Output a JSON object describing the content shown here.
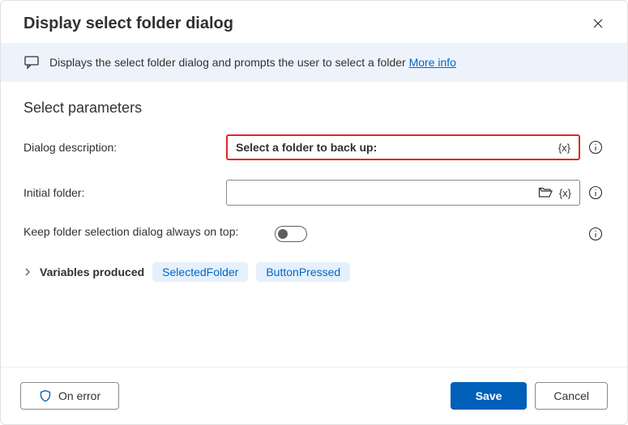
{
  "header": {
    "title": "Display select folder dialog"
  },
  "banner": {
    "text": "Displays the select folder dialog and prompts the user to select a folder ",
    "link": "More info"
  },
  "section": {
    "title": "Select parameters"
  },
  "fields": {
    "dialog_description": {
      "label": "Dialog description:",
      "value": "Select a folder to back up:"
    },
    "initial_folder": {
      "label": "Initial folder:",
      "value": ""
    },
    "keep_on_top": {
      "label": "Keep folder selection dialog always on top:",
      "toggled": false
    }
  },
  "variables": {
    "label": "Variables produced",
    "items": [
      "SelectedFolder",
      "ButtonPressed"
    ]
  },
  "footer": {
    "on_error": "On error",
    "save": "Save",
    "cancel": "Cancel"
  },
  "icons": {
    "variable_token": "{x}"
  }
}
